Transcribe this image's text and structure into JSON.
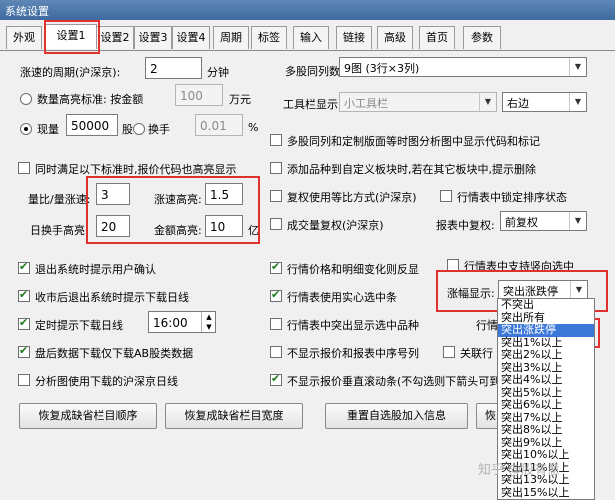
{
  "window": {
    "title": "系统设置"
  },
  "tabs": [
    "外观",
    "设置1",
    "设置2",
    "设置3",
    "设置4",
    "周期",
    "标签",
    "输入",
    "链接",
    "高级",
    "首页",
    "参数"
  ],
  "left": {
    "period_label": "涨速的周期(沪深京):",
    "period_value": "2",
    "period_unit": "分钟",
    "volume_radio": "数量高亮标准: 按金额",
    "volume_value": "100",
    "volume_unit": "万元",
    "hand_radio": "现量",
    "hand_value": "50000",
    "hand_unit": "股",
    "turnover_radio": "换手",
    "turnover_value": "0.01",
    "turnover_unit": "%",
    "both_check": "同时满足以下标准时,报价代码也高亮显示",
    "ratio_label": "量比/量涨速:",
    "ratio_value": "3",
    "speed_label": "涨速高亮:",
    "speed_value": "1.5",
    "hand_high_label": "日换手高亮:",
    "hand_high_value": "20",
    "amount_label": "金额高亮:",
    "amount_value": "10",
    "amount_unit": "亿",
    "exit_confirm": "退出系统时提示用户确认",
    "close_download": "收市后退出系统时提示下载日线",
    "timed_download": "定时提示下载日线",
    "timed_value": "16:00",
    "post_download": "盘后数据下载仅下载AB股类数据",
    "analysis_download": "分析图使用下载的沪深京日线"
  },
  "right": {
    "multi_label": "多股同列数:",
    "multi_value": "9图 (3行×3列)",
    "toolbar_label": "工具栏显示:",
    "toolbar_value": "小工具栏",
    "toolbar_pos": "右边",
    "show_code": "多股同列和定制版面等时图分析图中显示代码和标记",
    "add_block": "添加品种到自定义板块时,若在其它板块中,提示删除",
    "restore_ratio": "复权使用等比方式(沪深京)",
    "lock_sort": "行情表中锁定排序状态",
    "volume_restore": "成交量复权(沪深京)",
    "report_restore_label": "报表中复权:",
    "report_restore_value": "前复权",
    "price_color": "行情价格和明细变化则反显",
    "vertical_select": "行情表中支持竖向选中",
    "solid_select": "行情表使用实心选中条",
    "change_label": "涨幅显示:",
    "change_value": "突出涨跌停",
    "highlight_select": "行情表中突出显示选中品种",
    "hidden_label": "行情",
    "hide_quote": "不显示报价和报表中序号列",
    "related": "关联行",
    "hide_scroll": "不显示报价垂直滚动条(不勾选则下箭头可到下"
  },
  "dropdown": {
    "options": [
      "不突出",
      "突出所有",
      "突出涨跌停",
      "突出1%以上",
      "突出2%以上",
      "突出3%以上",
      "突出4%以上",
      "突出5%以上",
      "突出6%以上",
      "突出7%以上",
      "突出8%以上",
      "突出9%以上",
      "突出10%以上",
      "突出11%以上",
      "突出13%以上",
      "突出15%以上"
    ],
    "selected": "突出涨跌停"
  },
  "buttons": {
    "b1": "恢复成缺省栏目顺序",
    "b2": "恢复成缺省栏目宽度",
    "b3": "重置自选股加入信息",
    "b4": "恢"
  },
  "watermark": "知乎 @股有意"
}
